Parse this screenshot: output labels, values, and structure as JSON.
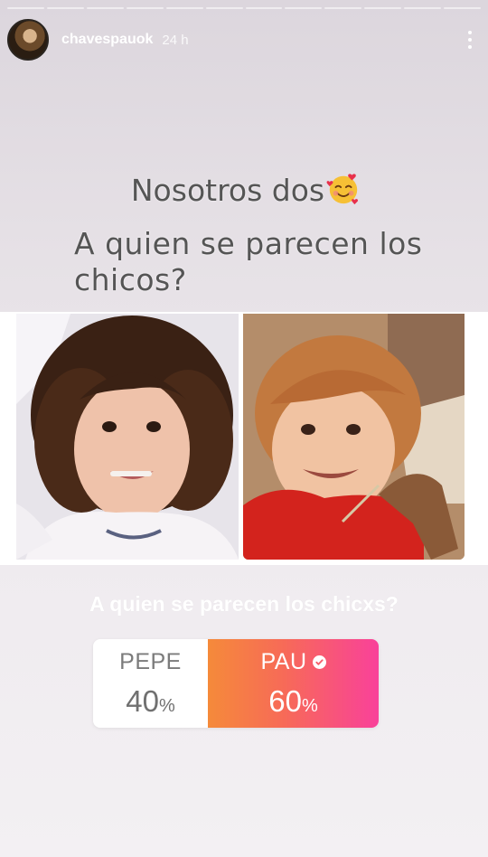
{
  "story": {
    "progress_total": 12,
    "progress_done": 0
  },
  "header": {
    "username": "chavespauok",
    "time": "24 h",
    "avatar_icon": "profile-avatar",
    "more_icon": "more-vertical-icon"
  },
  "caption": {
    "line1": "Nosotros dos",
    "line1_emoji": "smiling-face-with-hearts",
    "line2": "A quien se parecen los chicos?"
  },
  "photos": [
    {
      "name": "child-curly-hair-photo"
    },
    {
      "name": "child-red-sweater-photo"
    }
  ],
  "poll": {
    "question": "A quien se parecen los chicxs?",
    "options": [
      {
        "label": "PEPE",
        "percent": "40",
        "percent_sign": "%",
        "selected": false
      },
      {
        "label": "PAU",
        "percent": "60",
        "percent_sign": "%",
        "selected": true
      }
    ],
    "accent_start": "#f58a3a",
    "accent_end": "#f9419a"
  }
}
